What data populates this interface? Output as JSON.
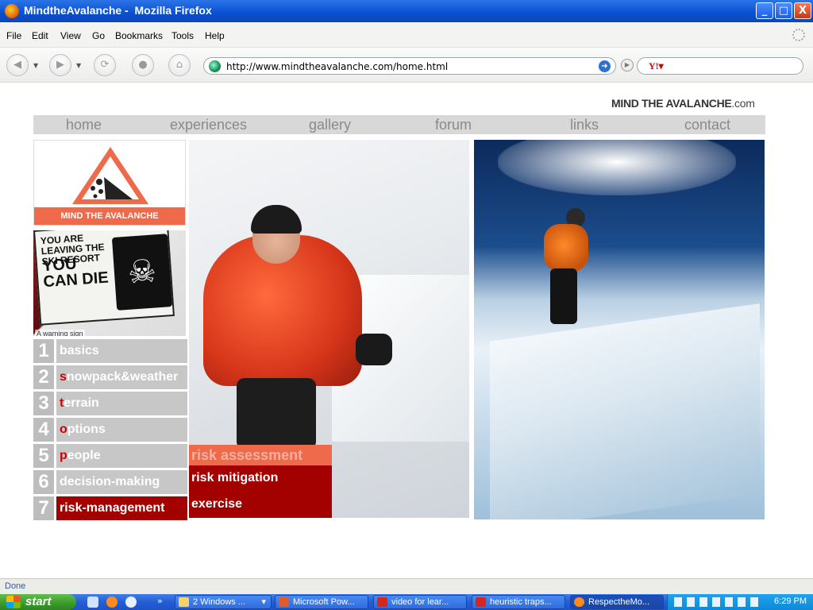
{
  "window": {
    "title": "MindtheAvalanche -  Mozilla Firefox",
    "minimize": "_",
    "maximize": "□",
    "close": "X"
  },
  "menu": [
    "File",
    "Edit",
    "View",
    "Go",
    "Bookmarks",
    "Tools",
    "Help"
  ],
  "navbar": {
    "back": "◀",
    "forward": "▶",
    "reload": "⟳",
    "stop": "●",
    "home": "⌂",
    "url": "http://www.mindtheavalanche.com/home.html",
    "go": "➜",
    "search_go": "▶",
    "search_engine": "Y!▾"
  },
  "site": {
    "brand_main": "MIND THE AVALANCHE",
    "brand_domain": ".com",
    "logo_band": "MIND THE AVALANCHE",
    "topnav": [
      "home",
      "experiences",
      "gallery",
      "forum",
      "links",
      "contact"
    ],
    "sign": {
      "line1": "YOU ARE LEAVING THE SKI RESORT",
      "line2": "YOU CAN DIE",
      "caption": "A warning sign"
    },
    "lessons": [
      {
        "num": "1",
        "first": "",
        "rest": "basics"
      },
      {
        "num": "2",
        "first": "s",
        "rest": "nowpack&weather"
      },
      {
        "num": "3",
        "first": "t",
        "rest": "errain"
      },
      {
        "num": "4",
        "first": "o",
        "rest": "ptions"
      },
      {
        "num": "5",
        "first": "p",
        "rest": "eople"
      },
      {
        "num": "6",
        "first": "",
        "rest": "decision-making"
      },
      {
        "num": "7",
        "first": "",
        "rest": "risk-management"
      }
    ],
    "submenu": {
      "risk_assessment": "risk assessment",
      "risk_mitigation": "risk mitigation",
      "exercise": "exercise"
    }
  },
  "status": "Done",
  "taskbar": {
    "start": "start",
    "more": "»",
    "tasks": [
      {
        "label": "2 Windows ...",
        "caret": "▾"
      },
      {
        "label": "Microsoft Pow..."
      },
      {
        "label": "video for lear..."
      },
      {
        "label": "heuristic traps..."
      },
      {
        "label": "RespectheMo..."
      }
    ],
    "clock": "6:29 PM"
  },
  "colors": {
    "accent_red": "#a30000",
    "coral": "#ef6a4b",
    "nav_gray": "#d8d8d8"
  }
}
